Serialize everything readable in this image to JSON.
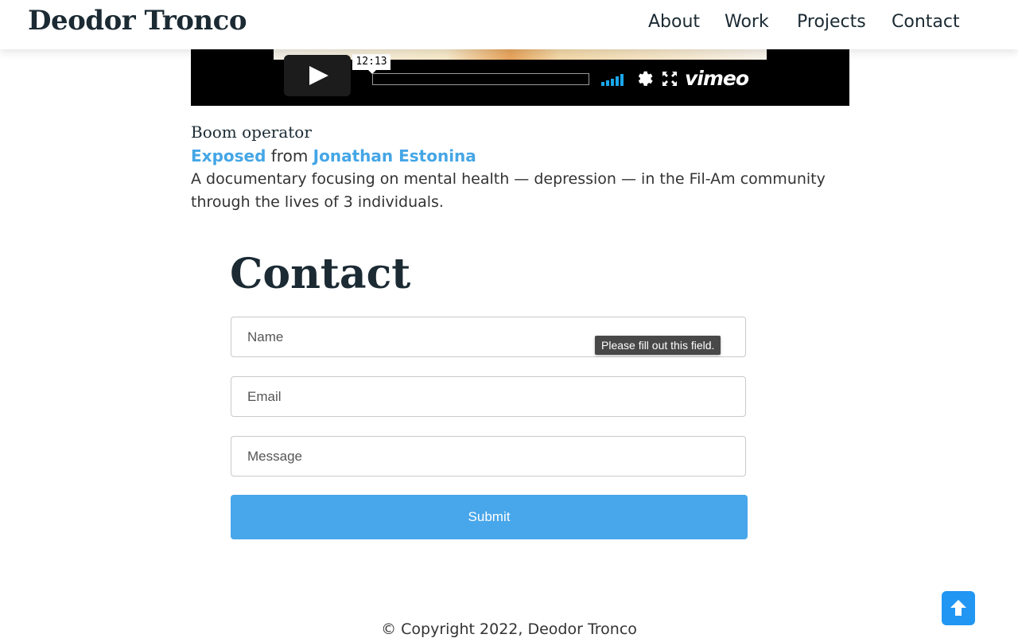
{
  "header": {
    "site_title": "Deodor Tronco",
    "nav": [
      "About",
      "Work",
      "Projects",
      "Contact"
    ]
  },
  "video": {
    "timestamp": "12:13",
    "brand": "vimeo",
    "icons": [
      "play-icon",
      "volume-icon",
      "settings-gear-icon",
      "fullscreen-icon"
    ]
  },
  "credit": {
    "role": "Boom operator",
    "film_title": "Exposed",
    "from_word": "from",
    "author": "Jonathan Estonina",
    "description": "A documentary focusing on mental health — depression — in the Fil-Am community through the lives of 3 individuals."
  },
  "contact": {
    "heading": "Contact",
    "name_placeholder": "Name",
    "email_placeholder": "Email",
    "message_placeholder": "Message",
    "validation_message": "Please fill out this field.",
    "submit_label": "Submit"
  },
  "footer": {
    "copyright": "© Copyright 2022, Deodor Tronco"
  },
  "colors": {
    "accent": "#48a6ea",
    "link": "#45a6e6",
    "to_top": "#2196f3",
    "text": "#1b2a33"
  }
}
